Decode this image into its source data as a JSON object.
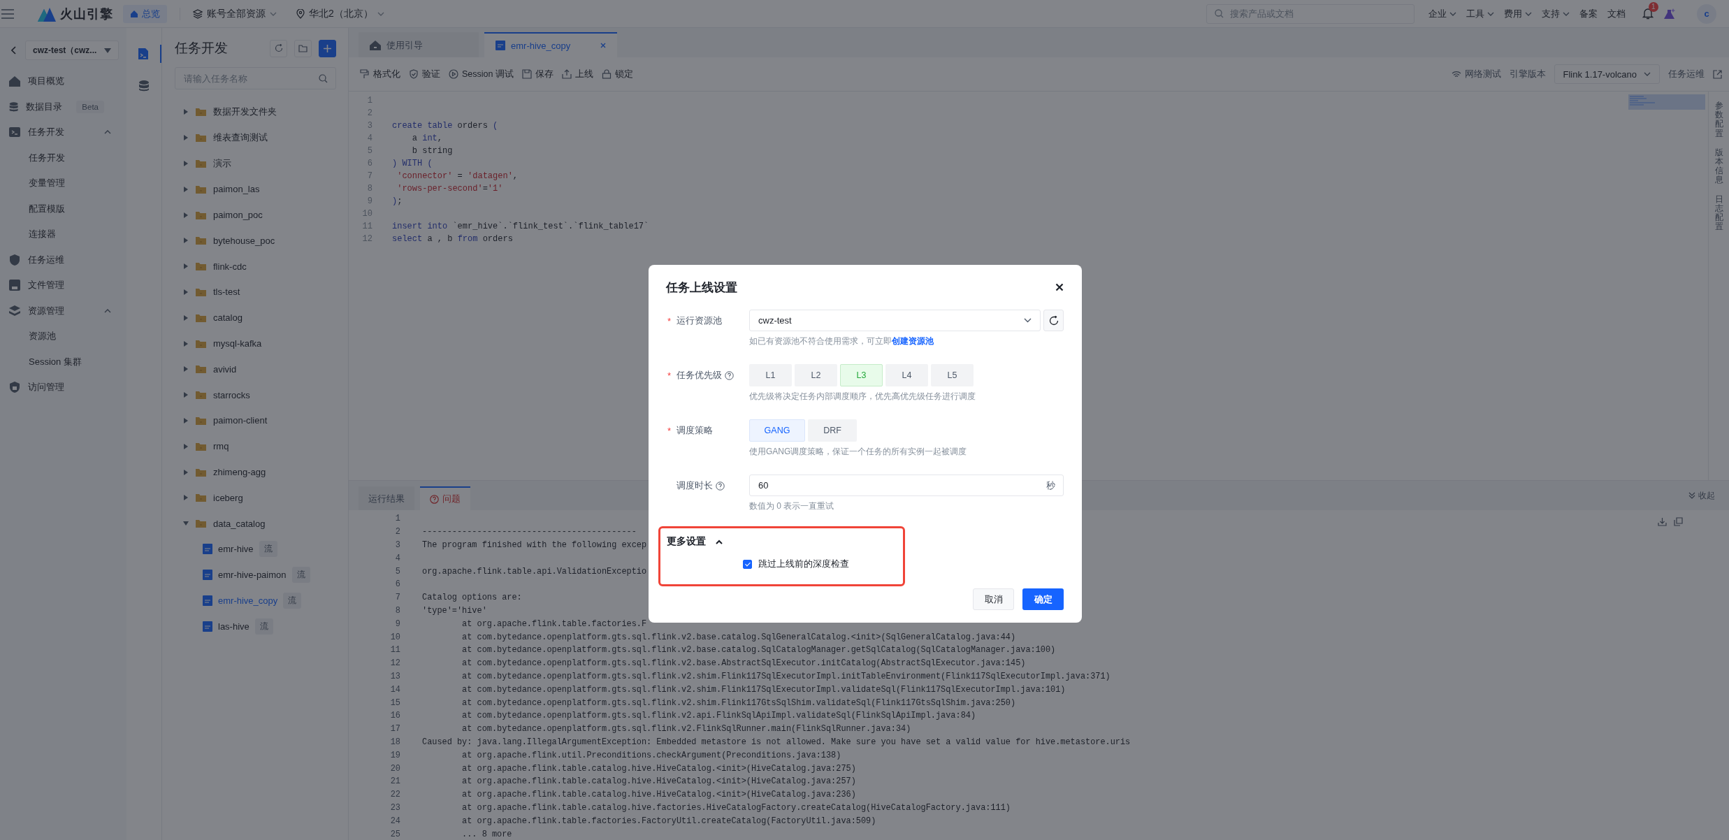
{
  "top_bar": {
    "logo": "火山引擎",
    "home_tab": "总览",
    "account_scope": "账号全部资源",
    "region": "华北2（北京）",
    "search": {
      "placeholder": "搜索产品或文档"
    },
    "menus": [
      "企业",
      "工具",
      "费用",
      "支持"
    ],
    "links": [
      "备案",
      "文档"
    ],
    "notification_badge": "1",
    "avatar": "c"
  },
  "sidebar": {
    "project": "cwz-test（cwz...",
    "items": [
      {
        "label": "项目概览"
      },
      {
        "label": "数据目录",
        "badge": "Beta"
      },
      {
        "label": "任务开发",
        "expanded": true,
        "children": [
          {
            "label": "任务开发"
          },
          {
            "label": "变量管理"
          },
          {
            "label": "配置模版"
          },
          {
            "label": "连接器"
          }
        ]
      },
      {
        "label": "任务运维"
      },
      {
        "label": "文件管理"
      },
      {
        "label": "资源管理",
        "expanded": true,
        "children": [
          {
            "label": "资源池"
          },
          {
            "label": "Session 集群"
          }
        ]
      },
      {
        "label": "访问管理"
      }
    ]
  },
  "tree": {
    "title": "任务开发",
    "search": {
      "placeholder": "请输入任务名称"
    },
    "items": [
      {
        "label": "数据开发文件夹",
        "expanded": false
      },
      {
        "label": "维表查询测试",
        "expanded": false
      },
      {
        "label": "演示",
        "expanded": false
      },
      {
        "label": "paimon_las",
        "expanded": false
      },
      {
        "label": "paimon_poc",
        "expanded": false
      },
      {
        "label": "bytehouse_poc",
        "expanded": false
      },
      {
        "label": "flink-cdc",
        "expanded": false
      },
      {
        "label": "tls-test",
        "expanded": false
      },
      {
        "label": "catalog",
        "expanded": false
      },
      {
        "label": "mysql-kafka",
        "expanded": false
      },
      {
        "label": "avivid",
        "expanded": false
      },
      {
        "label": "starrocks",
        "expanded": false
      },
      {
        "label": "paimon-client",
        "expanded": false
      },
      {
        "label": "rmq",
        "expanded": false
      },
      {
        "label": "zhimeng-agg",
        "expanded": false
      },
      {
        "label": "iceberg",
        "expanded": false
      },
      {
        "label": "data_catalog",
        "expanded": true,
        "children": [
          {
            "label": "emr-hive",
            "tag": "流",
            "selected": false
          },
          {
            "label": "emr-hive-paimon",
            "tag": "流",
            "selected": false
          },
          {
            "label": "emr-hive_copy",
            "tag": "流",
            "selected": true
          },
          {
            "label": "las-hive",
            "tag": "流",
            "selected": false
          }
        ]
      }
    ]
  },
  "editor": {
    "tabs": [
      {
        "label": "使用引导",
        "selected": false,
        "closable": false
      },
      {
        "label": "emr-hive_copy",
        "selected": true,
        "closable": true
      }
    ],
    "toolbar": [
      "格式化",
      "验证",
      "Session 调试",
      "保存",
      "上线",
      "锁定"
    ],
    "network_test": "网络测试",
    "engine_label": "引擎版本",
    "engine_version": "Flink 1.17-volcano",
    "ops_link": "任务运维",
    "lines": [
      {
        "n": "1"
      },
      {
        "n": "2"
      },
      {
        "n": "3",
        "tokens": [
          {
            "kind": "kw",
            "text": "create table"
          },
          {
            "kind": "plain",
            "text": " orders "
          },
          {
            "kind": "kw",
            "text": "("
          }
        ]
      },
      {
        "n": "4",
        "tokens": [
          {
            "kind": "plain",
            "text": "    a "
          },
          {
            "kind": "kw",
            "text": "int"
          },
          {
            "kind": "plain",
            "text": ","
          }
        ]
      },
      {
        "n": "5",
        "tokens": [
          {
            "kind": "plain",
            "text": "    b string"
          }
        ]
      },
      {
        "n": "6",
        "tokens": [
          {
            "kind": "kw",
            "text": ") WITH ("
          }
        ]
      },
      {
        "n": "7",
        "tokens": [
          {
            "kind": "str",
            "text": " 'connector'"
          },
          {
            "kind": "plain",
            "text": " = "
          },
          {
            "kind": "str",
            "text": "'datagen'"
          },
          {
            "kind": "plain",
            "text": ","
          }
        ]
      },
      {
        "n": "8",
        "tokens": [
          {
            "kind": "str",
            "text": " 'rows-per-second'"
          },
          {
            "kind": "plain",
            "text": "="
          },
          {
            "kind": "str",
            "text": "'1'"
          }
        ]
      },
      {
        "n": "9",
        "tokens": [
          {
            "kind": "kw",
            "text": ")"
          },
          {
            "kind": "plain",
            "text": ";"
          }
        ]
      },
      {
        "n": "10"
      },
      {
        "n": "11",
        "tokens": [
          {
            "kind": "kw",
            "text": "insert into"
          },
          {
            "kind": "plain",
            "text": " `emr_hive`.`flink_test`.`flink_table17`"
          }
        ]
      },
      {
        "n": "12",
        "tokens": [
          {
            "kind": "kw",
            "text": "select"
          },
          {
            "kind": "plain",
            "text": " a , b "
          },
          {
            "kind": "kw",
            "text": "from"
          },
          {
            "kind": "plain",
            "text": " orders"
          }
        ]
      }
    ],
    "right_rail": [
      "参数配置",
      "版本信息",
      "日志配置"
    ]
  },
  "bottom_panel": {
    "tabs": [
      {
        "label": "运行结果",
        "selected": false
      },
      {
        "label": "问题",
        "selected": true
      }
    ],
    "collapse": "收起",
    "lines": [
      {
        "n": "1"
      },
      {
        "n": "2",
        "text": "-------------------------------------------"
      },
      {
        "n": "3",
        "text": "The program finished with the following excep"
      },
      {
        "n": "4"
      },
      {
        "n": "5",
        "text": "org.apache.flink.table.api.ValidationExceptio"
      },
      {
        "n": "6"
      },
      {
        "n": "7",
        "text": "Catalog options are:"
      },
      {
        "n": "8",
        "text": "'type'='hive'"
      },
      {
        "n": "9",
        "text": "        at org.apache.flink.table.factories.F"
      },
      {
        "n": "10",
        "text": "        at com.bytedance.openplatform.gts.sql.flink.v2.base.catalog.SqlGeneralCatalog.<init>(SqlGeneralCatalog.java:44)"
      },
      {
        "n": "11",
        "text": "        at com.bytedance.openplatform.gts.sql.flink.v2.base.catalog.SqlCatalogManager.getSqlCatalog(SqlCatalogManager.java:100)"
      },
      {
        "n": "12",
        "text": "        at com.bytedance.openplatform.gts.sql.flink.v2.base.AbstractSqlExecutor.initCatalog(AbstractSqlExecutor.java:145)"
      },
      {
        "n": "13",
        "text": "        at com.bytedance.openplatform.gts.sql.flink.v2.shim.Flink117SqlExecutorImpl.initTableEnvironment(Flink117SqlExecutorImpl.java:371)"
      },
      {
        "n": "14",
        "text": "        at com.bytedance.openplatform.gts.sql.flink.v2.shim.Flink117SqlExecutorImpl.validateSql(Flink117SqlExecutorImpl.java:101)"
      },
      {
        "n": "15",
        "text": "        at com.bytedance.openplatform.gts.sql.flink.v2.shim.Flink117GtsSqlShim.validateSql(Flink117GtsSqlShim.java:250)"
      },
      {
        "n": "16",
        "text": "        at com.bytedance.openplatform.gts.sql.flink.v2.api.FlinkSqlApiImpl.validateSql(FlinkSqlApiImpl.java:84)"
      },
      {
        "n": "17",
        "text": "        at com.bytedance.openplatform.gts.sql.flink.v2.FlinkSqlRunner.main(FlinkSqlRunner.java:34)"
      },
      {
        "n": "18",
        "text": "Caused by: java.lang.IllegalArgumentException: Embedded metastore is not allowed. Make sure you have set a valid value for hive.metastore.uris"
      },
      {
        "n": "19",
        "text": "        at org.apache.flink.util.Preconditions.checkArgument(Preconditions.java:138)"
      },
      {
        "n": "20",
        "text": "        at org.apache.flink.table.catalog.hive.HiveCatalog.<init>(HiveCatalog.java:275)"
      },
      {
        "n": "21",
        "text": "        at org.apache.flink.table.catalog.hive.HiveCatalog.<init>(HiveCatalog.java:257)"
      },
      {
        "n": "22",
        "text": "        at org.apache.flink.table.catalog.hive.HiveCatalog.<init>(HiveCatalog.java:236)"
      },
      {
        "n": "23",
        "text": "        at org.apache.flink.table.catalog.hive.factories.HiveCatalogFactory.createCatalog(HiveCatalogFactory.java:111)"
      },
      {
        "n": "24",
        "text": "        at org.apache.flink.table.factories.FactoryUtil.createCatalog(FactoryUtil.java:509)"
      },
      {
        "n": "25",
        "text": "        ... 8 more"
      }
    ]
  },
  "dialog": {
    "title": "任务上线设置",
    "fields": [
      {
        "kind": "select",
        "label": "运行资源池",
        "required_mark": "*",
        "info": false,
        "value": "cwz-test",
        "help": "如已有资源池不符合使用需求，可立即",
        "help_link": "创建资源池"
      },
      {
        "kind": "levels",
        "label": "任务优先级",
        "required_mark": "*",
        "info": true,
        "options": [
          {
            "label": "L1",
            "selected": false
          },
          {
            "label": "L2",
            "selected": false
          },
          {
            "label": "L3",
            "selected": true
          },
          {
            "label": "L4",
            "selected": false
          },
          {
            "label": "L5",
            "selected": false
          }
        ],
        "help": "优先级将决定任务内部调度顺序，优先高优先级任务进行调度"
      },
      {
        "kind": "choice",
        "label": "调度策略",
        "required_mark": "*",
        "info": false,
        "options": [
          {
            "label": "GANG",
            "selected": true
          },
          {
            "label": "DRF",
            "selected": false
          }
        ],
        "help": "使用GANG调度策略，保证一个任务的所有实例一起被调度"
      },
      {
        "kind": "number",
        "label": "调度时长",
        "info": true,
        "value": "60",
        "suffix": "秒",
        "help": "数值为 0 表示一直重试"
      }
    ],
    "more": {
      "label": "更多设置",
      "expanded": true,
      "highlighted": true,
      "checkbox": {
        "label": "跳过上线前的深度检查",
        "checked": true
      }
    },
    "buttons": [
      {
        "label": "取消",
        "kind": "default"
      },
      {
        "label": "确定",
        "kind": "primary"
      }
    ]
  }
}
